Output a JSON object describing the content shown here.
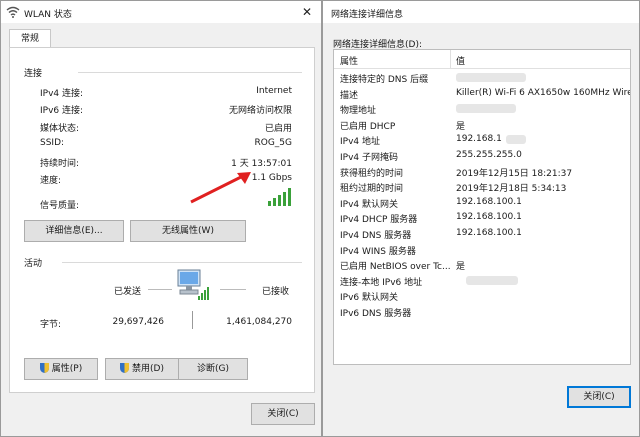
{
  "left": {
    "title": "WLAN 状态",
    "tab": "常规",
    "connection": {
      "heading": "连接",
      "rows": [
        {
          "label": "IPv4 连接:",
          "value": "Internet"
        },
        {
          "label": "IPv6 连接:",
          "value": "无网络访问权限"
        },
        {
          "label": "媒体状态:",
          "value": "已启用"
        },
        {
          "label": "SSID:",
          "value": "ROG_5G"
        },
        {
          "label": "持续时间:",
          "value": "1 天 13:57:01"
        },
        {
          "label": "速度:",
          "value": "1.1 Gbps"
        }
      ],
      "signal_label": "信号质量:",
      "details_btn": "详细信息(E)...",
      "wireless_btn": "无线属性(W)"
    },
    "activity": {
      "heading": "活动",
      "sent": "已发送",
      "received": "已接收",
      "bytes_label": "字节:",
      "bytes_sent": "29,697,426",
      "bytes_received": "1,461,084,270"
    },
    "buttons": {
      "properties": "属性(P)",
      "disable": "禁用(D)",
      "diagnose": "诊断(G)",
      "close": "关闭(C)"
    },
    "colors": {
      "arrow": "#e02020",
      "signal": "#3aa13a"
    }
  },
  "right": {
    "title": "网络连接详细信息",
    "section_label": "网络连接详细信息(D):",
    "col_property": "属性",
    "col_value": "值",
    "rows": [
      {
        "p": "连接特定的 DNS 后缀",
        "v": ""
      },
      {
        "p": "描述",
        "v": "Killer(R) Wi-Fi 6 AX1650w 160MHz Wire"
      },
      {
        "p": "物理地址",
        "v": ""
      },
      {
        "p": "已启用 DHCP",
        "v": "是"
      },
      {
        "p": "IPv4 地址",
        "v": "192.168.1"
      },
      {
        "p": "IPv4 子网掩码",
        "v": "255.255.255.0"
      },
      {
        "p": "获得租约的时间",
        "v": "2019年12月15日 18:21:37"
      },
      {
        "p": "租约过期的时间",
        "v": "2019年12月18日 5:34:13"
      },
      {
        "p": "IPv4 默认网关",
        "v": "192.168.100.1"
      },
      {
        "p": "IPv4 DHCP 服务器",
        "v": "192.168.100.1"
      },
      {
        "p": "IPv4 DNS 服务器",
        "v": "192.168.100.1"
      },
      {
        "p": "IPv4 WINS 服务器",
        "v": ""
      },
      {
        "p": "已启用 NetBIOS over Tc...",
        "v": "是"
      },
      {
        "p": "连接-本地 IPv6 地址",
        "v": ""
      },
      {
        "p": "IPv6 默认网关",
        "v": ""
      },
      {
        "p": "IPv6 DNS 服务器",
        "v": ""
      }
    ],
    "close_btn": "关闭(C)"
  }
}
